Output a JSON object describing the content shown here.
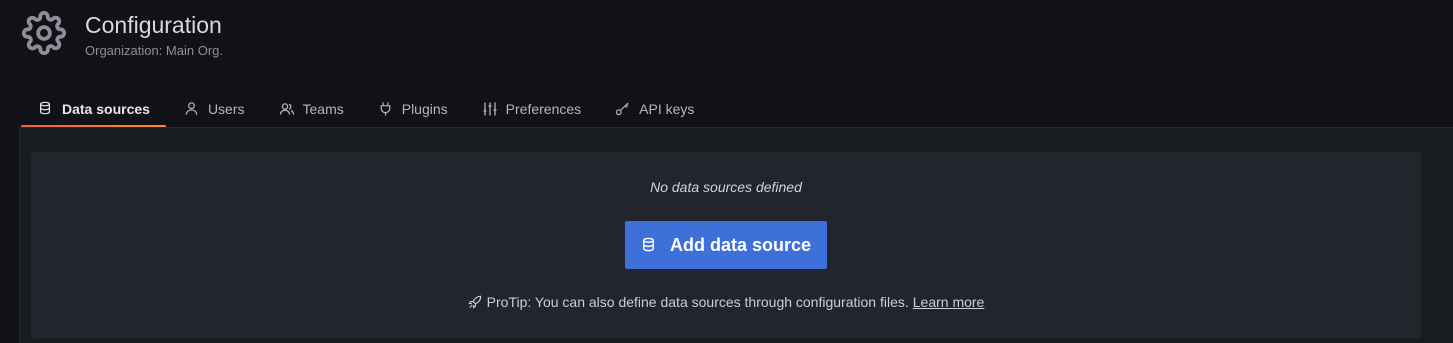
{
  "header": {
    "title": "Configuration",
    "subtitle": "Organization: Main Org.",
    "icon": "gear-icon"
  },
  "tabs": [
    {
      "label": "Data sources",
      "icon": "database-icon",
      "active": true
    },
    {
      "label": "Users",
      "icon": "user-icon",
      "active": false
    },
    {
      "label": "Teams",
      "icon": "users-icon",
      "active": false
    },
    {
      "label": "Plugins",
      "icon": "plug-icon",
      "active": false
    },
    {
      "label": "Preferences",
      "icon": "sliders-icon",
      "active": false
    },
    {
      "label": "API keys",
      "icon": "key-icon",
      "active": false
    }
  ],
  "empty_state": {
    "message": "No data sources defined",
    "button_label": "Add data source",
    "button_icon": "database-icon",
    "protip_icon": "rocket-icon",
    "protip_text": "ProTip: You can also define data sources through configuration files.",
    "protip_link": "Learn more"
  },
  "colors": {
    "accent": "#3d71d9",
    "active_tab_underline": "#f55f3e",
    "background": "#111217",
    "panel": "#22252b"
  }
}
